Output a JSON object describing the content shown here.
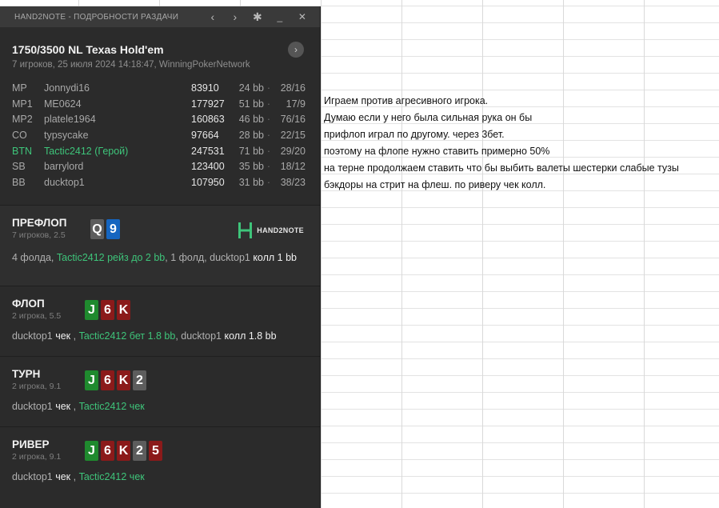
{
  "sheet": {
    "notes": [
      "Играем против агресивного игрока.",
      "Думаю если у него была сильная рука он бы",
      "прифлоп играл по другому. через 3бет.",
      "поэтому на флопе нужно ставить примерно 50%",
      "на терне продолжаем ставить что бы выбить валеты шестерки слабые тузы",
      "бэкдоры на стрит на флеш. по риверу чек колл."
    ]
  },
  "window": {
    "title": "HAND2NOTE - ПОДРОБНОСТИ РАЗДАЧИ",
    "back_icon": "‹",
    "forward_icon": "›",
    "settings_icon": "✱",
    "minimize_icon": "_",
    "close_icon": "✕"
  },
  "game": {
    "title": "1750/3500 NL Texas Hold'em",
    "subtitle": "7 игроков, 25 июля 2024 14:18:47, WinningPokerNetwork",
    "next_icon": "›"
  },
  "players": [
    {
      "pos": "MP",
      "name": "Jonnydi16",
      "stack": "83910",
      "bb": "24 bb",
      "stat": "28/16",
      "hero": false
    },
    {
      "pos": "MP1",
      "name": "ME0624",
      "stack": "177927",
      "bb": "51 bb",
      "stat": "17/9",
      "hero": false
    },
    {
      "pos": "MP2",
      "name": "platele1964",
      "stack": "160863",
      "bb": "46 bb",
      "stat": "76/16",
      "hero": false
    },
    {
      "pos": "CO",
      "name": "typsycake",
      "stack": "97664",
      "bb": "28 bb",
      "stat": "22/15",
      "hero": false
    },
    {
      "pos": "BTN",
      "name": "Tactic2412 (Герой)",
      "stack": "247531",
      "bb": "71 bb",
      "stat": "29/20",
      "hero": true
    },
    {
      "pos": "SB",
      "name": "barrylord",
      "stack": "123400",
      "bb": "35 bb",
      "stat": "18/12",
      "hero": false
    },
    {
      "pos": "BB",
      "name": "ducktop1",
      "stack": "107950",
      "bb": "31 bb",
      "stat": "38/23",
      "hero": false
    }
  ],
  "separator": "·",
  "logo": {
    "text": "HAND2NOTE"
  },
  "streets": {
    "preflop": {
      "name": "ПРЕФЛОП",
      "sub": "7 игроков, 2.5",
      "cards": [
        {
          "rank": "Q",
          "color": "gray"
        },
        {
          "rank": "9",
          "color": "blue"
        }
      ],
      "a1": "4 фолда, ",
      "a2": "Tactic2412 рейз до 2 bb",
      "a3": ", 1 фолд, ducktop1 ",
      "a4": "колл 1 bb"
    },
    "flop": {
      "name": "ФЛОП",
      "sub": "2 игрока, 5.5",
      "cards": [
        {
          "rank": "J",
          "color": "green"
        },
        {
          "rank": "6",
          "color": "red"
        },
        {
          "rank": "K",
          "color": "red"
        }
      ],
      "a1": "ducktop1 ",
      "a2": "чек",
      "a3": " , ",
      "a4": "Tactic2412 бет 1.8 bb",
      "a5": ", ducktop1 ",
      "a6": "колл 1.8 bb"
    },
    "turn": {
      "name": "ТУРН",
      "sub": "2 игрока, 9.1",
      "cards": [
        {
          "rank": "J",
          "color": "green"
        },
        {
          "rank": "6",
          "color": "red"
        },
        {
          "rank": "K",
          "color": "red"
        },
        {
          "rank": "2",
          "color": "gray"
        }
      ],
      "a1": "ducktop1 ",
      "a2": "чек",
      "a3": " , ",
      "a4": "Tactic2412 чек"
    },
    "river": {
      "name": "РИВЕР",
      "sub": "2 игрока, 9.1",
      "cards": [
        {
          "rank": "J",
          "color": "green"
        },
        {
          "rank": "6",
          "color": "red"
        },
        {
          "rank": "K",
          "color": "red"
        },
        {
          "rank": "2",
          "color": "gray"
        },
        {
          "rank": "5",
          "color": "red"
        }
      ],
      "a1": "ducktop1 ",
      "a2": "чек",
      "a3": " , ",
      "a4": "Tactic2412 чек"
    }
  }
}
